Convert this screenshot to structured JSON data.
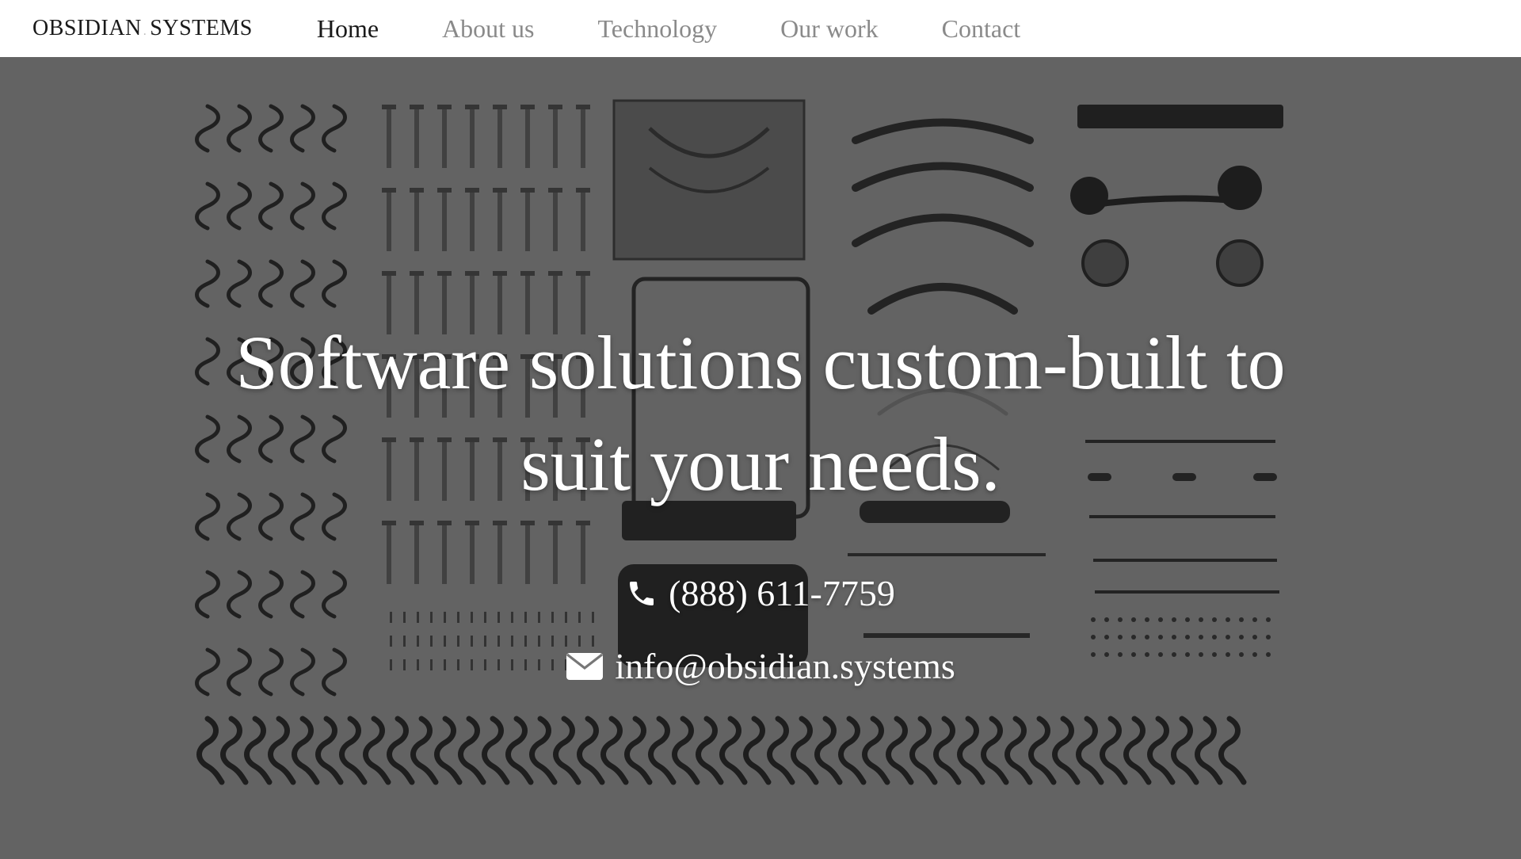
{
  "nav": {
    "logo_left": "OBSIDIAN",
    "logo_dot": ".",
    "logo_right": "SYSTEMS",
    "items": [
      {
        "label": "Home",
        "active": true
      },
      {
        "label": "About us",
        "active": false
      },
      {
        "label": "Technology",
        "active": false
      },
      {
        "label": "Our work",
        "active": false
      },
      {
        "label": "Contact",
        "active": false
      }
    ]
  },
  "hero": {
    "headline_line1": "Software solutions custom-built to",
    "headline_line2": "suit your needs.",
    "phone": "(888) 611-7759",
    "email": "info@obsidian.systems",
    "phone_icon": "phone-icon",
    "email_icon": "envelope-icon",
    "background": "typewriter parts flat-lay photo"
  },
  "colors": {
    "nav_bg": "#ffffff",
    "active_link": "#1a1a1a",
    "inactive_link": "#8a8a8a",
    "hero_bg": "#6b6b6b",
    "hero_text": "#ffffff"
  }
}
